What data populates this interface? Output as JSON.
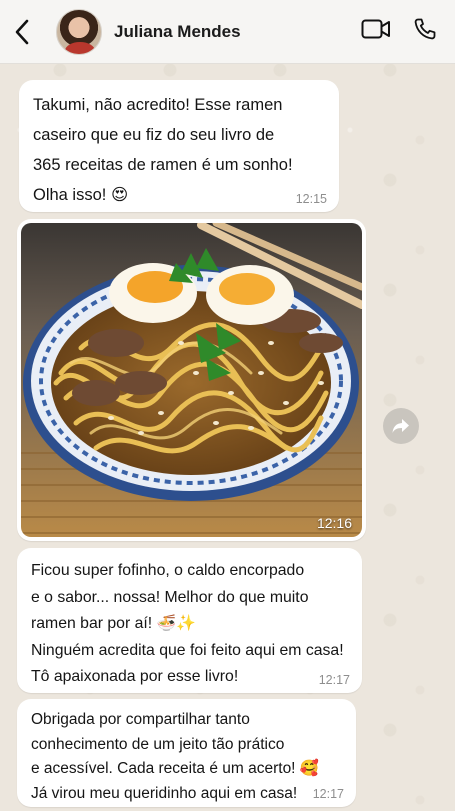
{
  "header": {
    "contact_name": "Juliana Mendes",
    "back_icon": "chevron-left-icon",
    "video_icon": "video-call-icon",
    "phone_icon": "phone-call-icon"
  },
  "messages": [
    {
      "type": "text",
      "text": "Takumi, não acredito! Esse ramen\ncaseiro que eu fiz do seu livro de\n365 receitas de ramen é um sonho!\nOlha isso! 😍",
      "time": "12:15"
    },
    {
      "type": "image",
      "image_desc": "ramen-bowl-photo",
      "time": "12:16"
    },
    {
      "type": "text",
      "text": "Ficou super fofinho, o caldo encorpado\ne o sabor... nossa! Melhor do que muito\nramen bar por aí! 🍜✨\nNinguém acredita que foi feito aqui em casa!\nTô apaixonada por esse livro!",
      "time": "12:17"
    },
    {
      "type": "text",
      "text": "Obrigada por compartilhar tanto\nconhecimento de um jeito tão prático\ne acessível. Cada receita é um acerto! 🥰\nJá virou meu queridinho aqui em casa!",
      "time": "12:17"
    }
  ],
  "share_icon": "forward-arrow-icon",
  "colors": {
    "bubble": "#ffffff",
    "background": "#efeae2",
    "header": "#f6f5f3",
    "timestamp": "#8e8e8e"
  }
}
